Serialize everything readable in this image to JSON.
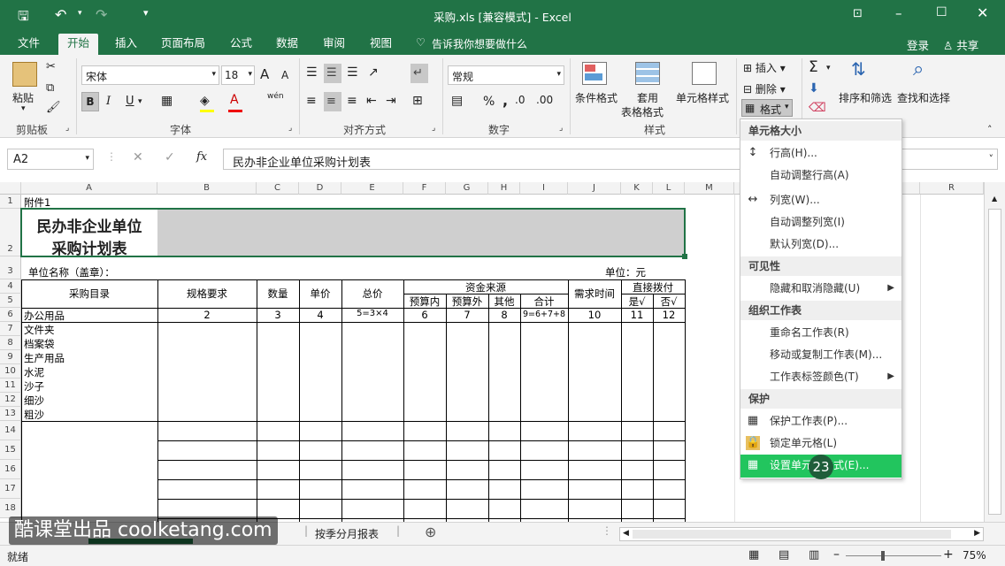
{
  "titlebar": {
    "title": "采购.xls  [兼容模式] - Excel"
  },
  "tabs": [
    "文件",
    "开始",
    "插入",
    "页面布局",
    "公式",
    "数据",
    "审阅",
    "视图"
  ],
  "tell_me": "告诉我你想要做什么",
  "account": {
    "login": "登录",
    "share": "共享"
  },
  "ribbon": {
    "paste": "粘贴",
    "font_name": "宋体",
    "font_size": "18",
    "number_format": "常规",
    "conditional_format": "条件格式",
    "table_format_1": "套用",
    "table_format_2": "表格格式",
    "cell_style": "单元格样式",
    "insert": "插入",
    "delete": "删除",
    "format": "格式",
    "sort_filter": "排序和筛选",
    "find_select": "查找和选择",
    "bold": "B",
    "italic": "I",
    "underline": "U",
    "font_a_up": "A",
    "font_a_down": "A",
    "wen": "wén",
    "percent": "%",
    "comma": ",",
    "groups": {
      "clipboard": "剪贴板",
      "font": "字体",
      "align": "对齐方式",
      "number": "数字",
      "styles": "样式"
    }
  },
  "formula": {
    "namebox": "A2",
    "fx": "fx",
    "content": "民办非企业单位采购计划表"
  },
  "columns": [
    "A",
    "B",
    "C",
    "D",
    "E",
    "F",
    "G",
    "H",
    "I",
    "J",
    "K",
    "L",
    "M",
    "R"
  ],
  "rows": [
    "1",
    "2",
    "3",
    "4",
    "5",
    "6",
    "7",
    "8",
    "9",
    "10",
    "11",
    "12",
    "13",
    "14",
    "15",
    "16",
    "17",
    "18"
  ],
  "sheet": {
    "a1": "附件1",
    "title_line1": "民办非企业单位",
    "title_line2": "采购计划表",
    "unit_name": "单位名称（盖章）：",
    "unit": "单位：元",
    "hdr_catalog": "采购目录",
    "hdr_spec": "规格要求",
    "hdr_qty": "数量",
    "hdr_price": "单价",
    "hdr_total": "总价",
    "hdr_funds": "资金来源",
    "hdr_budget_in": "预算内",
    "hdr_budget_out": "预算外",
    "hdr_other": "其他",
    "hdr_sum": "合计",
    "hdr_need_time": "需求时间",
    "hdr_direct": "直接拨付",
    "hdr_yes": "是√",
    "hdr_no": "否√",
    "row6": [
      "办公用品",
      "2",
      "3",
      "4",
      "5=3×4",
      "6",
      "7",
      "8",
      "9=6+7+8",
      "10",
      "11",
      "12"
    ],
    "items": [
      "文件夹",
      "档案袋",
      "生产用品",
      "水泥",
      "沙子",
      "细沙",
      "粗沙"
    ]
  },
  "menu": {
    "h1": "单元格大小",
    "row_height": "行高(H)...",
    "auto_row": "自动调整行高(A)",
    "col_width": "列宽(W)...",
    "auto_col": "自动调整列宽(I)",
    "default_width": "默认列宽(D)...",
    "h2": "可见性",
    "hide": "隐藏和取消隐藏(U)",
    "h3": "组织工作表",
    "rename": "重命名工作表(R)",
    "move_copy": "移动或复制工作表(M)...",
    "tab_color": "工作表标签颜色(T)",
    "h4": "保护",
    "protect": "保护工作表(P)...",
    "lock": "锁定单元格(L)",
    "format_cells": "设置单元格格式(E)..."
  },
  "badge": "23",
  "sheet_tabs": {
    "tab2": "按季分月报表"
  },
  "status": {
    "ready": "就绪",
    "zoom": "75%"
  },
  "watermark": "酷课堂出品 coolketang.com",
  "colors": {
    "excel_green": "#217346",
    "highlight": "#22c55e"
  }
}
